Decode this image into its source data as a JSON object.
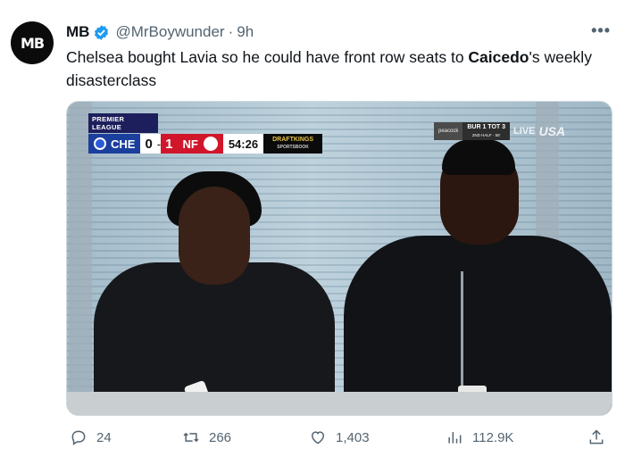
{
  "tweet": {
    "avatar_text": "MB",
    "name": "MB",
    "handle": "@MrBoywunder",
    "separator": "·",
    "time": "9h",
    "more_icon": "more-horizontal-icon",
    "text_before": "Chelsea bought Lavia so he could have front row seats to ",
    "text_bold": "Caicedo",
    "text_after": "'s weekly disasterclass"
  },
  "media": {
    "scorebug": {
      "league": "PREMIER LEAGUE",
      "team_a": "CHE",
      "score_a": "0",
      "dash": "-",
      "score_b": "1",
      "team_b": "NF",
      "clock": "54:26",
      "sponsor_line1": "DRAFTKINGS",
      "sponsor_line2": "SPORTSBOOK"
    },
    "right_bug": {
      "peacock": "peacock",
      "score_line": "BUR 1  TOT 3",
      "half": "2ND HALF · 55'",
      "live": "LIVE",
      "network": "USA"
    }
  },
  "actions": {
    "replies": "24",
    "retweets": "266",
    "likes": "1,403",
    "views": "112.9K"
  },
  "colors": {
    "accent": "#1d9bf0",
    "muted": "#536471",
    "text": "#0f1419"
  }
}
